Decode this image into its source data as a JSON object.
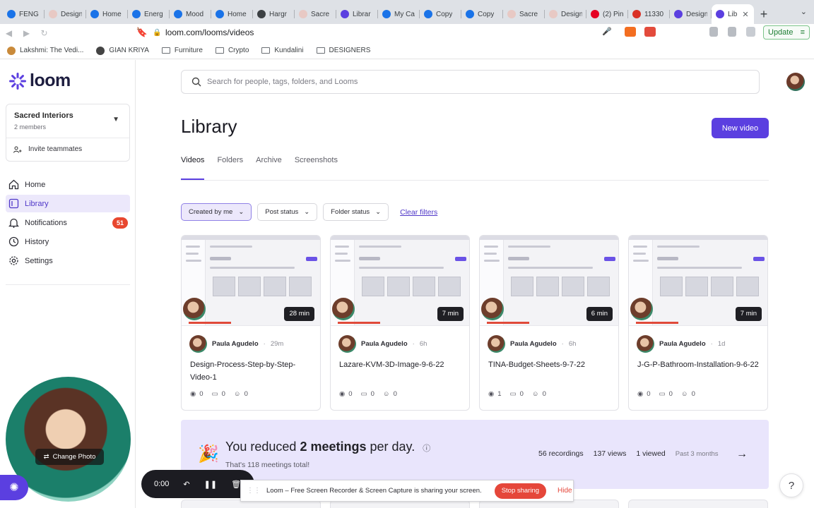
{
  "browser": {
    "tabs": [
      {
        "label": "FENG",
        "color": "#1a73e8"
      },
      {
        "label": "Design",
        "color": "#e8c9c4"
      },
      {
        "label": "Home",
        "color": "#1a73e8"
      },
      {
        "label": "Energ",
        "color": "#1a73e8"
      },
      {
        "label": "Mood",
        "color": "#1a73e8"
      },
      {
        "label": "Home",
        "color": "#1a73e8"
      },
      {
        "label": "Hargr",
        "color": "#3c4043"
      },
      {
        "label": "Sacre",
        "color": "#e8c9c4"
      },
      {
        "label": "Librar",
        "color": "#5b3fe0"
      },
      {
        "label": "My Ca",
        "color": "#1a73e8"
      },
      {
        "label": "Copy",
        "color": "#1a73e8"
      },
      {
        "label": "Copy",
        "color": "#1a73e8"
      },
      {
        "label": "Sacre",
        "color": "#e8c9c4"
      },
      {
        "label": "Design",
        "color": "#e8c9c4"
      },
      {
        "label": "(2) Pin",
        "color": "#e60023"
      },
      {
        "label": "11330",
        "color": "#d93025"
      },
      {
        "label": "Design",
        "color": "#5b3fe0"
      },
      {
        "label": "Lib",
        "color": "#5b3fe0",
        "active": true
      }
    ],
    "url": "loom.com/looms/videos",
    "update_label": "Update",
    "bookmarks": [
      {
        "label": "Lakshmi: The Vedi...",
        "kind": "site"
      },
      {
        "label": "GIAN KRIYA",
        "kind": "site"
      },
      {
        "label": "Furniture",
        "kind": "folder"
      },
      {
        "label": "Crypto",
        "kind": "folder"
      },
      {
        "label": "Kundalini",
        "kind": "folder"
      },
      {
        "label": "DESIGNERS",
        "kind": "folder"
      }
    ]
  },
  "sidebar": {
    "logo_text": "loom",
    "workspace": {
      "name": "Sacred Interiors",
      "members": "2 members"
    },
    "invite_label": "Invite teammates",
    "nav": [
      {
        "label": "Home",
        "icon": "home-icon"
      },
      {
        "label": "Library",
        "icon": "library-icon",
        "active": true
      },
      {
        "label": "Notifications",
        "icon": "bell-icon",
        "badge": "51"
      },
      {
        "label": "History",
        "icon": "history-icon"
      },
      {
        "label": "Settings",
        "icon": "gear-icon"
      }
    ]
  },
  "search": {
    "placeholder": "Search for people, tags, folders, and Looms"
  },
  "page": {
    "title": "Library",
    "new_video_label": "New video",
    "tabs": [
      "Videos",
      "Folders",
      "Archive",
      "Screenshots"
    ],
    "filters": [
      "Created by me",
      "Post status",
      "Folder status"
    ],
    "clear_filters": "Clear filters"
  },
  "videos": [
    {
      "duration": "28 min",
      "author": "Paula Agudelo",
      "age": "29m",
      "title": "Design-Process-Step-by-Step-Video-1",
      "views": "0",
      "comments": "0",
      "reactions": "0"
    },
    {
      "duration": "7 min",
      "author": "Paula Agudelo",
      "age": "6h",
      "title": "Lazare-KVM-3D-Image-9-6-22",
      "views": "0",
      "comments": "0",
      "reactions": "0"
    },
    {
      "duration": "6 min",
      "author": "Paula Agudelo",
      "age": "6h",
      "title": "TINA-Budget-Sheets-9-7-22",
      "views": "1",
      "comments": "0",
      "reactions": "0"
    },
    {
      "duration": "7 min",
      "author": "Paula Agudelo",
      "age": "1d",
      "title": "J-G-P-Bathroom-Installation-9-6-22",
      "views": "0",
      "comments": "0",
      "reactions": "0"
    }
  ],
  "banner": {
    "prefix": "You reduced",
    "highlight": "2 meetings",
    "suffix": "per day.",
    "subtext": "That's 118 meetings total!",
    "recordings": "56 recordings",
    "views": "137 views",
    "viewed": "1 viewed",
    "period": "Past 3 months"
  },
  "recorder": {
    "change_photo": "Change Photo",
    "timer": "0:00",
    "share_message": "Loom – Free Screen Recorder & Screen Capture is sharing your screen.",
    "stop_label": "Stop sharing",
    "hide_label": "Hide"
  },
  "help_label": "?"
}
